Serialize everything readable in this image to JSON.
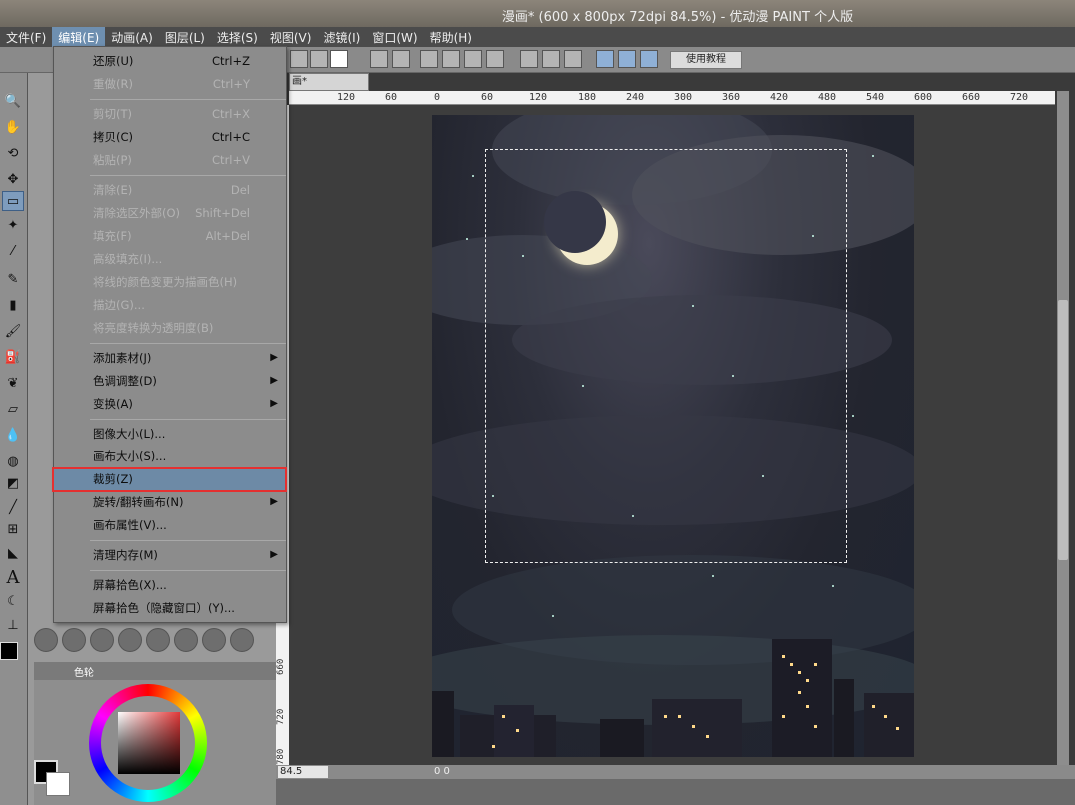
{
  "window": {
    "title": "漫画* (600 x 800px 72dpi 84.5%) - 优动漫 PAINT 个人版"
  },
  "menubar": {
    "items": [
      "文件(F)",
      "编辑(E)",
      "动画(A)",
      "图层(L)",
      "选择(S)",
      "视图(V)",
      "滤镜(I)",
      "窗口(W)",
      "帮助(H)"
    ]
  },
  "toolbar": {
    "help_label": "使用教程"
  },
  "document": {
    "tab_label": "画*",
    "zoom": "84.5",
    "coords": "0 0"
  },
  "ruler": {
    "ticks": [
      "120",
      "60",
      "0",
      "60",
      "120",
      "180",
      "240",
      "300",
      "360",
      "420",
      "480",
      "540",
      "600",
      "660",
      "720"
    ],
    "vticks": [
      "660",
      "720",
      "780"
    ]
  },
  "color_panel": {
    "tab_label": "色轮",
    "foreground": "#000000",
    "background": "#ffffff"
  },
  "edit_menu": {
    "items": [
      {
        "label": "还原(U)",
        "shortcut": "Ctrl+Z",
        "enabled": true
      },
      {
        "label": "重做(R)",
        "shortcut": "Ctrl+Y",
        "enabled": false
      },
      {
        "label": "剪切(T)",
        "shortcut": "Ctrl+X",
        "enabled": false
      },
      {
        "label": "拷贝(C)",
        "shortcut": "Ctrl+C",
        "enabled": true
      },
      {
        "label": "粘贴(P)",
        "shortcut": "Ctrl+V",
        "enabled": false
      },
      {
        "label": "清除(E)",
        "shortcut": "Del",
        "enabled": false
      },
      {
        "label": "清除选区外部(O)",
        "shortcut": "Shift+Del",
        "enabled": false
      },
      {
        "label": "填充(F)",
        "shortcut": "Alt+Del",
        "enabled": false
      },
      {
        "label": "高级填充(I)...",
        "shortcut": "",
        "enabled": false
      },
      {
        "label": "将线的颜色变更为描画色(H)",
        "shortcut": "",
        "enabled": false
      },
      {
        "label": "描边(G)...",
        "shortcut": "",
        "enabled": false
      },
      {
        "label": "将亮度转换为透明度(B)",
        "shortcut": "",
        "enabled": false
      },
      {
        "label": "添加素材(J)",
        "shortcut": "",
        "enabled": true,
        "submenu": true
      },
      {
        "label": "色调调整(D)",
        "shortcut": "",
        "enabled": true,
        "submenu": true
      },
      {
        "label": "变换(A)",
        "shortcut": "",
        "enabled": true,
        "submenu": true
      },
      {
        "label": "图像大小(L)...",
        "shortcut": "",
        "enabled": true
      },
      {
        "label": "画布大小(S)...",
        "shortcut": "",
        "enabled": true
      },
      {
        "label": "裁剪(Z)",
        "shortcut": "",
        "enabled": true,
        "highlighted": true
      },
      {
        "label": "旋转/翻转画布(N)",
        "shortcut": "",
        "enabled": true,
        "submenu": true
      },
      {
        "label": "画布属性(V)...",
        "shortcut": "",
        "enabled": true
      },
      {
        "label": "清理内存(M)",
        "shortcut": "",
        "enabled": true,
        "submenu": true
      },
      {
        "label": "屏幕拾色(X)...",
        "shortcut": "",
        "enabled": true
      },
      {
        "label": "屏幕拾色（隐藏窗口）(Y)...",
        "shortcut": "",
        "enabled": true
      }
    ]
  },
  "colors": {
    "highlight_border": "#e53030",
    "menu_highlight": "#6d8aa6"
  }
}
